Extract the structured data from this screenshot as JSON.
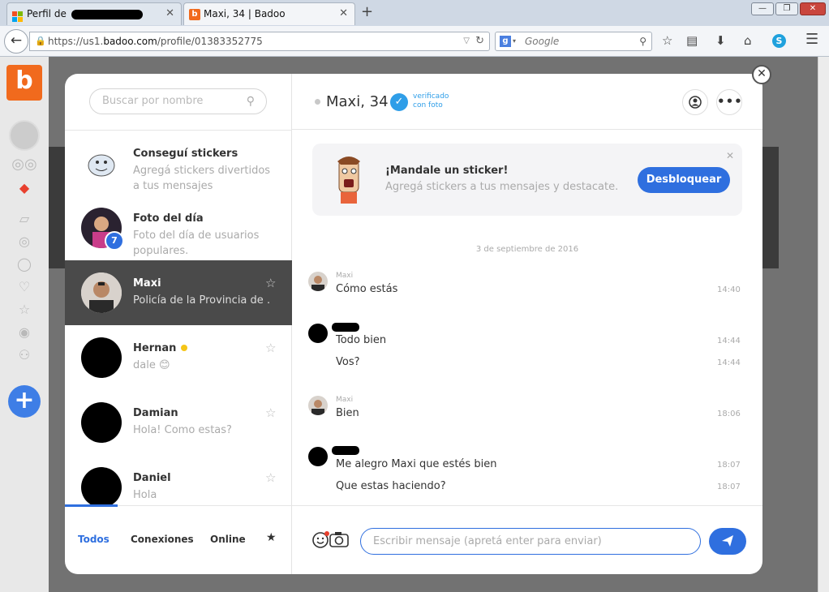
{
  "browser": {
    "tabs": [
      {
        "label": "Perfil de",
        "active": false
      },
      {
        "label": "Maxi, 34 | Badoo",
        "active": true
      }
    ],
    "new_tab": "+",
    "url": {
      "prefix": "https://us1.",
      "domain": "badoo.com",
      "path": "/profile/01383352775"
    },
    "search_placeholder": "Google"
  },
  "search": {
    "placeholder": "Buscar por nombre"
  },
  "conversations": [
    {
      "name": "Conseguí stickers",
      "preview": "Agregá stickers divertidos a tus mensajes",
      "avatar": "sticker-icon"
    },
    {
      "name": "Foto del día",
      "preview": "Foto del día de usuarios populares.",
      "badge": "7"
    },
    {
      "name": "Maxi",
      "preview": "Policía de la Provincia de …",
      "selected": true
    },
    {
      "name": "Hernan",
      "preview": "dale 😊",
      "online": true
    },
    {
      "name": "Damian",
      "preview": "Hola! Como estas?"
    },
    {
      "name": "Daniel",
      "preview": "Hola"
    }
  ],
  "filter_tabs": {
    "all": "Todos",
    "connections": "Conexiones",
    "online": "Online"
  },
  "chat_header": {
    "name": "Maxi, 34",
    "verified_text": "verificado con foto"
  },
  "promo": {
    "title": "¡Mandale un sticker!",
    "subtitle": "Agregá stickers a tus mensajes y destacate.",
    "button": "Desbloquear"
  },
  "date_separator": "3 de septiembre de 2016",
  "messages": [
    {
      "author": "Maxi",
      "text": "Cómo estás",
      "time": "14:40"
    },
    {
      "author": "",
      "text": "Todo bien",
      "time": "14:44"
    },
    {
      "author": "",
      "text": "Vos?",
      "time": "14:44"
    },
    {
      "author": "Maxi",
      "text": "Bien",
      "time": "18:06"
    },
    {
      "author": "",
      "text": "Me alegro Maxi que estés bien",
      "time": "18:07"
    },
    {
      "author": "",
      "text": "Que estas haciendo?",
      "time": "18:07"
    }
  ],
  "composer": {
    "placeholder": "Escribir mensaje (apretá enter para enviar)"
  },
  "colors": {
    "brand": "#f16a1d",
    "accent": "#2f6fdf",
    "verified": "#2f9ee8"
  }
}
